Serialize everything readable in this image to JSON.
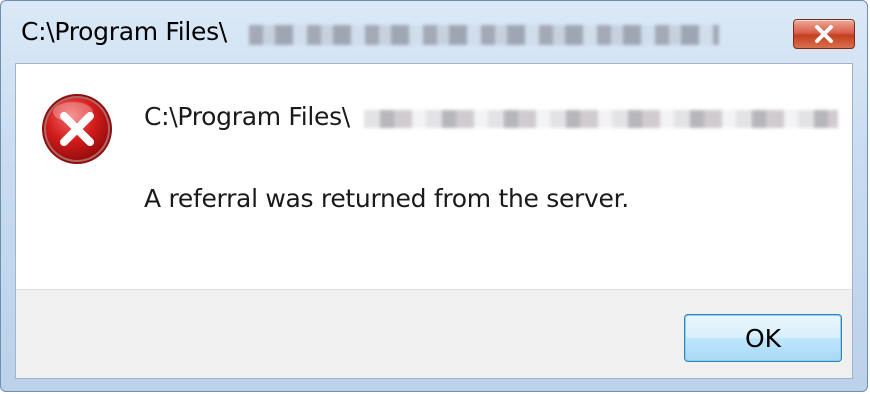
{
  "window": {
    "title": "C:\\Program Files\\"
  },
  "titlebar": {
    "close_icon": "close-x-icon"
  },
  "dialog": {
    "icon": "error-icon",
    "path_text": "C:\\Program Files\\",
    "message": "A referral was returned from the server."
  },
  "buttons": {
    "ok_label": "OK"
  },
  "colors": {
    "close_button": "#d9604a",
    "error_icon": "#c8102e",
    "ok_border": "#3c7fb1"
  }
}
